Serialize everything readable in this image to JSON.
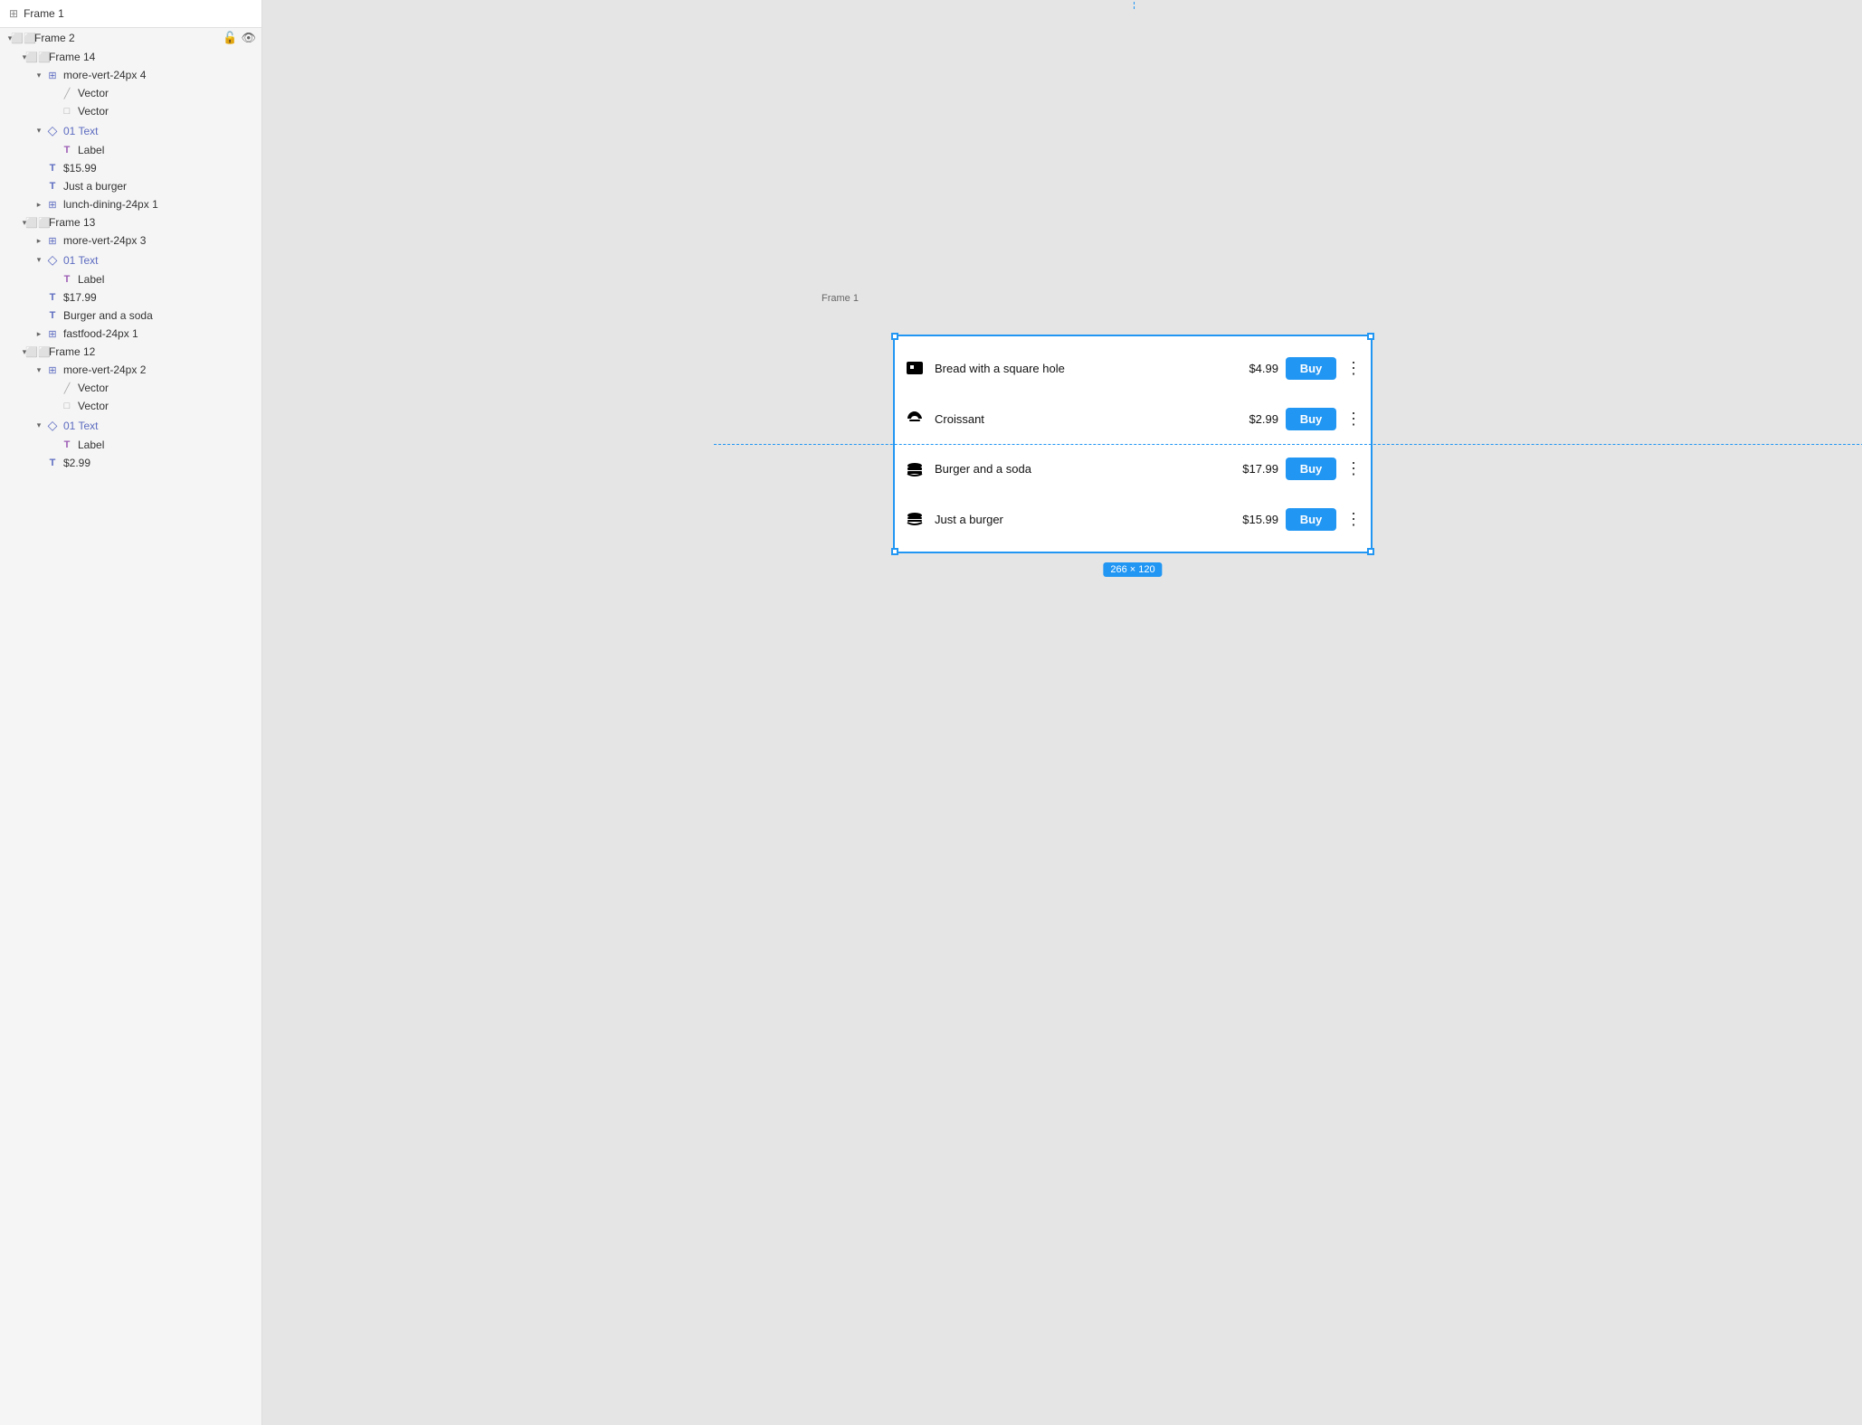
{
  "sidebar": {
    "root_title": "Frame 1",
    "items": [
      {
        "id": "frame2",
        "label": "Frame 2",
        "indent": 0,
        "type": "frame",
        "expanded": true,
        "selected": false,
        "has_actions": true
      },
      {
        "id": "frame14",
        "label": "Frame 14",
        "indent": 1,
        "type": "frame",
        "expanded": true,
        "selected": false
      },
      {
        "id": "more-vert-4",
        "label": "more-vert-24px 4",
        "indent": 2,
        "type": "component",
        "expanded": true,
        "selected": false
      },
      {
        "id": "vector1",
        "label": "Vector",
        "indent": 3,
        "type": "vector-line",
        "selected": false
      },
      {
        "id": "vector2",
        "label": "Vector",
        "indent": 3,
        "type": "vector-rect",
        "selected": false
      },
      {
        "id": "01text-1",
        "label": "01 Text",
        "indent": 2,
        "type": "component-diamond",
        "expanded": true,
        "selected": false
      },
      {
        "id": "label1",
        "label": "Label",
        "indent": 3,
        "type": "text-t-purple",
        "selected": false
      },
      {
        "id": "price1",
        "label": "$15.99",
        "indent": 2,
        "type": "text",
        "selected": false
      },
      {
        "id": "name1",
        "label": "Just a burger",
        "indent": 2,
        "type": "text",
        "selected": false
      },
      {
        "id": "lunch-dining",
        "label": "lunch-dining-24px 1",
        "indent": 2,
        "type": "component-collapsed",
        "selected": false
      },
      {
        "id": "frame13",
        "label": "Frame 13",
        "indent": 1,
        "type": "frame",
        "expanded": true,
        "selected": false
      },
      {
        "id": "more-vert-3",
        "label": "more-vert-24px 3",
        "indent": 2,
        "type": "component-collapsed",
        "selected": false
      },
      {
        "id": "01text-2",
        "label": "01 Text",
        "indent": 2,
        "type": "component-diamond",
        "expanded": true,
        "selected": false
      },
      {
        "id": "label2",
        "label": "Label",
        "indent": 3,
        "type": "text-t-purple",
        "selected": false
      },
      {
        "id": "price2",
        "label": "$17.99",
        "indent": 2,
        "type": "text",
        "selected": false
      },
      {
        "id": "name2",
        "label": "Burger and a soda",
        "indent": 2,
        "type": "text",
        "selected": false
      },
      {
        "id": "fastfood",
        "label": "fastfood-24px 1",
        "indent": 2,
        "type": "component-collapsed",
        "selected": false
      },
      {
        "id": "frame12",
        "label": "Frame 12",
        "indent": 1,
        "type": "frame",
        "expanded": true,
        "selected": false
      },
      {
        "id": "more-vert-2",
        "label": "more-vert-24px 2",
        "indent": 2,
        "type": "component",
        "expanded": true,
        "selected": false
      },
      {
        "id": "vector3",
        "label": "Vector",
        "indent": 3,
        "type": "vector-line",
        "selected": false
      },
      {
        "id": "vector4",
        "label": "Vector",
        "indent": 3,
        "type": "vector-rect",
        "selected": false
      },
      {
        "id": "01text-3",
        "label": "01 Text",
        "indent": 2,
        "type": "component-diamond",
        "expanded": true,
        "selected": false
      },
      {
        "id": "label3",
        "label": "Label",
        "indent": 3,
        "type": "text-t-purple",
        "selected": false
      },
      {
        "id": "price3",
        "label": "$2.99",
        "indent": 2,
        "type": "text",
        "selected": false
      }
    ]
  },
  "canvas": {
    "frame_label": "Frame 1",
    "size_badge": "266 × 120",
    "food_rows": [
      {
        "icon": "🍞",
        "name": "Bread with a square hole",
        "price": "$4.99"
      },
      {
        "icon": "🥐",
        "name": "Croissant",
        "price": "$2.99"
      },
      {
        "icon": "🍔",
        "name": "Burger and a soda",
        "price": "$17.99"
      },
      {
        "icon": "🍔",
        "name": "Just a burger",
        "price": "$15.99"
      }
    ],
    "buy_label": "Buy"
  }
}
